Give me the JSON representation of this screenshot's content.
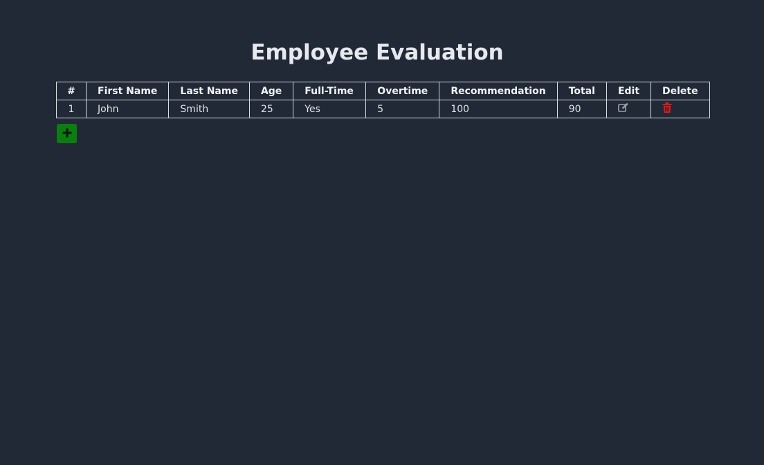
{
  "page": {
    "title": "Employee Evaluation"
  },
  "table": {
    "headers": {
      "index": "#",
      "first_name": "First Name",
      "last_name": "Last Name",
      "age": "Age",
      "full_time": "Full-Time",
      "overtime": "Overtime",
      "recommendation": "Recommendation",
      "total": "Total",
      "edit": "Edit",
      "delete": "Delete"
    },
    "rows": [
      {
        "index": "1",
        "first_name": "John",
        "last_name": "Smith",
        "age": "25",
        "full_time": "Yes",
        "overtime": "5",
        "recommendation": "100",
        "total": "90",
        "edit_icon": "pencil-square-icon",
        "delete_icon": "trash-icon"
      }
    ]
  },
  "actions": {
    "add_icon": "plus-icon"
  },
  "colors": {
    "background": "#212936",
    "add_button": "#0c7e11",
    "delete_icon": "#e0191b",
    "edit_icon": "#9ea3aa"
  }
}
